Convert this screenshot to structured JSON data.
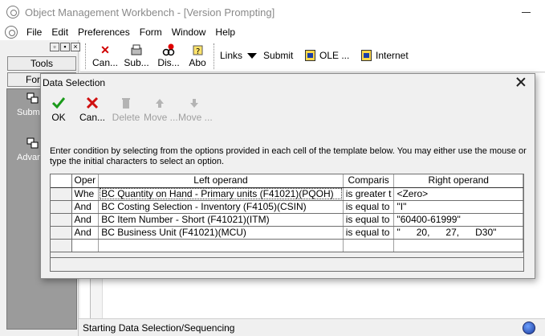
{
  "window": {
    "title": "Object Management Workbench - [Version Prompting]"
  },
  "menu": [
    "File",
    "Edit",
    "Preferences",
    "Form",
    "Window",
    "Help"
  ],
  "left_pane": {
    "tabs": [
      "Tools",
      "For"
    ],
    "items": [
      {
        "label": "Subm",
        "icon": "submit-icon"
      },
      {
        "label": "Advanc",
        "icon": "advanced-icon"
      }
    ]
  },
  "toolbar": {
    "buttons": [
      {
        "label": "Can...",
        "icon": "cancel-icon"
      },
      {
        "label": "Sub...",
        "icon": "submit-icon"
      },
      {
        "label": "Dis...",
        "icon": "display-icon"
      },
      {
        "label": "Abo",
        "icon": "about-icon"
      }
    ],
    "links_label": "Links",
    "submit_label": "Submit",
    "ole_label": "OLE ...",
    "internet_label": "Internet"
  },
  "status": {
    "text": "Starting Data Selection/Sequencing"
  },
  "dialog": {
    "title": "Data Selection",
    "buttons": [
      {
        "label": "OK",
        "icon": "ok-check-icon",
        "enabled": true
      },
      {
        "label": "Can...",
        "icon": "cancel-x-icon",
        "enabled": true
      },
      {
        "label": "Delete",
        "icon": "trash-icon",
        "enabled": false
      },
      {
        "label": "Move ...",
        "icon": "move-up-icon",
        "enabled": false
      },
      {
        "label": "Move ...",
        "icon": "move-down-icon",
        "enabled": false
      }
    ],
    "instruction": "Enter condition by selecting from the options provided in each cell of the template below. You may either use the mouse or type the initial characters to select an option.",
    "grid": {
      "headers": [
        "Oper",
        "Left operand",
        "Comparis",
        "Right operand"
      ],
      "rows": [
        {
          "oper": "Whe",
          "left": "BC Quantity on Hand - Primary units (F41021)(PQOH)",
          "comp": "is greater t",
          "right": "<Zero>"
        },
        {
          "oper": "And",
          "left": "BC Costing Selection - Inventory (F4105)(CSIN)",
          "comp": "is equal to",
          "right": "\"I\""
        },
        {
          "oper": "And",
          "left": "BC Item Number - Short (F41021)(ITM)",
          "comp": "is equal to",
          "right": "\"60400-61999\""
        },
        {
          "oper": "And",
          "left": "BC Business Unit (F41021)(MCU)",
          "comp": "is equal to",
          "right": "\"      20,      27,      D30\""
        }
      ]
    }
  }
}
